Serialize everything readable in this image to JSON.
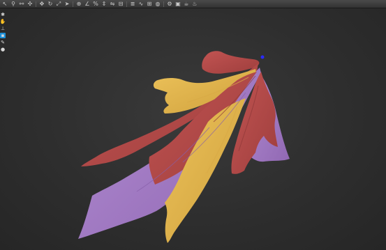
{
  "toolbar": {
    "tools": [
      {
        "icon": "select-arrow-icon",
        "glyph": "↖"
      },
      {
        "icon": "link-icon",
        "glyph": "⚲"
      },
      {
        "icon": "unlink-icon",
        "glyph": "⚯"
      },
      {
        "icon": "bind-icon",
        "glyph": "✣"
      },
      {
        "icon": "move-icon",
        "glyph": "✥"
      },
      {
        "icon": "rotate-icon",
        "glyph": "↻"
      },
      {
        "icon": "scale-icon",
        "glyph": "⤢"
      },
      {
        "icon": "cursor-icon",
        "glyph": "➤"
      },
      {
        "icon": "snap-icon",
        "glyph": "⊕"
      },
      {
        "icon": "angle-snap-icon",
        "glyph": "∠"
      },
      {
        "icon": "percent-snap-icon",
        "glyph": "%"
      },
      {
        "icon": "spinner-snap-icon",
        "glyph": "⇕"
      },
      {
        "icon": "mirror-icon",
        "glyph": "⇋"
      },
      {
        "icon": "align-icon",
        "glyph": "⊟"
      },
      {
        "icon": "layer-icon",
        "glyph": "≣"
      },
      {
        "icon": "curve-editor-icon",
        "glyph": "∿"
      },
      {
        "icon": "schematic-icon",
        "glyph": "⊞"
      },
      {
        "icon": "material-editor-icon",
        "glyph": "◍"
      },
      {
        "icon": "render-setup-icon",
        "glyph": "⚙"
      },
      {
        "icon": "render-frame-icon",
        "glyph": "▣"
      },
      {
        "icon": "render-icon",
        "glyph": "☕"
      },
      {
        "icon": "teapot-icon",
        "glyph": "♨"
      }
    ],
    "accent": "#1d8fd6"
  },
  "side_tools": [
    {
      "icon": "pin-icon",
      "glyph": "✱",
      "active": false
    },
    {
      "icon": "hand-icon",
      "glyph": "✋",
      "active": false
    },
    {
      "icon": "bone-icon",
      "glyph": "⊥",
      "active": false
    },
    {
      "icon": "selection-icon",
      "glyph": "▪",
      "active": true
    },
    {
      "icon": "brush-icon",
      "glyph": "✎",
      "active": false
    },
    {
      "icon": "sphere-icon",
      "glyph": "●",
      "active": false
    }
  ],
  "viewport": {
    "background": "#2e2e2e",
    "cloth_colors": {
      "red": "#b54a48",
      "yellow": "#e2b64c",
      "purple": "#a77fc8"
    },
    "pivot_color": "#2a2aff"
  }
}
